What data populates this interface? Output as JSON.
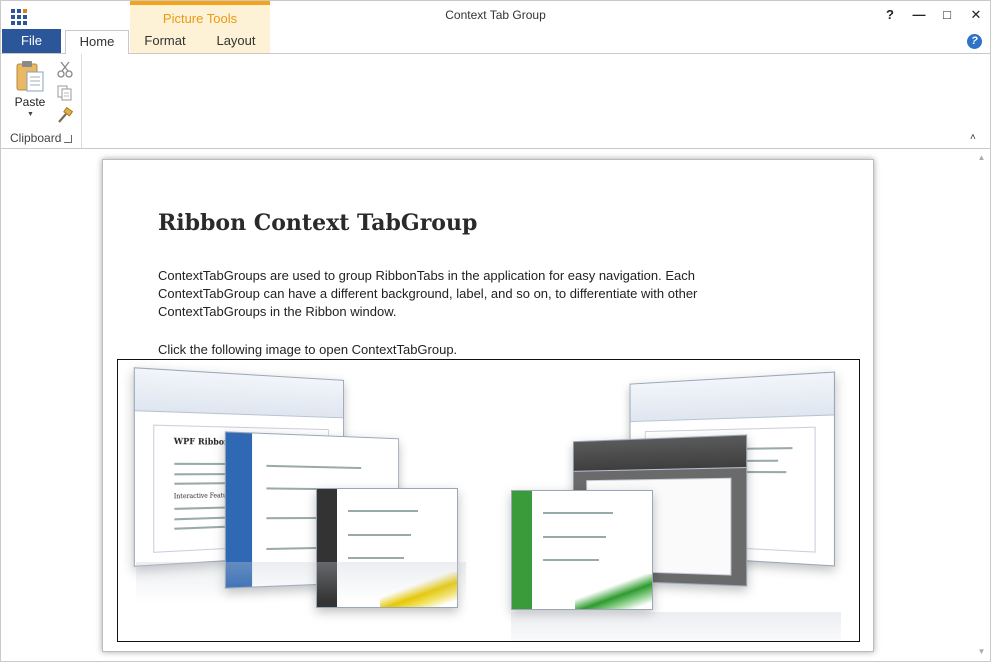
{
  "window": {
    "title": "Context Tab Group",
    "controls": {
      "help": "?",
      "minimize": "—",
      "maximize": "□",
      "close": "✕"
    }
  },
  "context_group": {
    "label": "Picture Tools",
    "color": "#f4a31b",
    "text_color": "#ea9b13"
  },
  "tabs": {
    "file": "File",
    "home": "Home",
    "format": "Format",
    "layout": "Layout"
  },
  "ribbon": {
    "clipboard": {
      "paste_label": "Paste",
      "group_label": "Clipboard",
      "icons": [
        "paste-icon",
        "cut-icon",
        "copy-icon",
        "format-painter-icon"
      ]
    },
    "collapse_glyph": "˄"
  },
  "document": {
    "heading": "Ribbon Context TabGroup",
    "paragraph": "ContextTabGroups are used to group RibbonTabs in the application for easy navigation. Each ContextTabGroup can have a different background, label, and so on, to differentiate with other ContextTabGroups in the Ribbon window.",
    "instruction": "Click the following image to open ContextTabGroup.",
    "image_text": {
      "doc_title": "WPF Ribbon",
      "features_title": "Interactive Features"
    }
  },
  "colors": {
    "file_tab": "#2b579a",
    "accent": "#2e73c8"
  }
}
